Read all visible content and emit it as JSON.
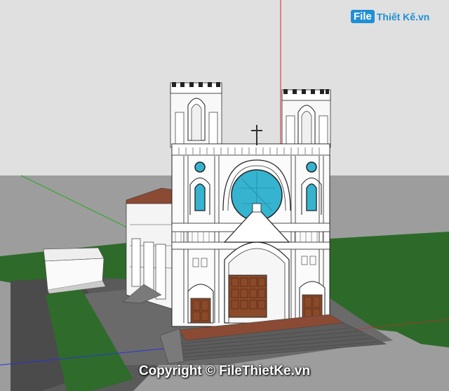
{
  "watermark": {
    "logo_file": "File",
    "logo_rest": "Thiết Kế.vn",
    "copyright": "Copyright © FileThietKe.vn"
  },
  "scene": {
    "sky_color": "#dcdcdc",
    "ground_color": "#9a9a9a",
    "grass_color": "#2f6b2a",
    "axis_red": "#e0201a",
    "axis_green": "#22aa22",
    "axis_blue": "#2a35d8",
    "window_glass": "#35b3cf",
    "door_wood": "#8a4a2a",
    "roof_color": "#8b4a33",
    "model_description_icon": "church-3d-model-icon"
  }
}
